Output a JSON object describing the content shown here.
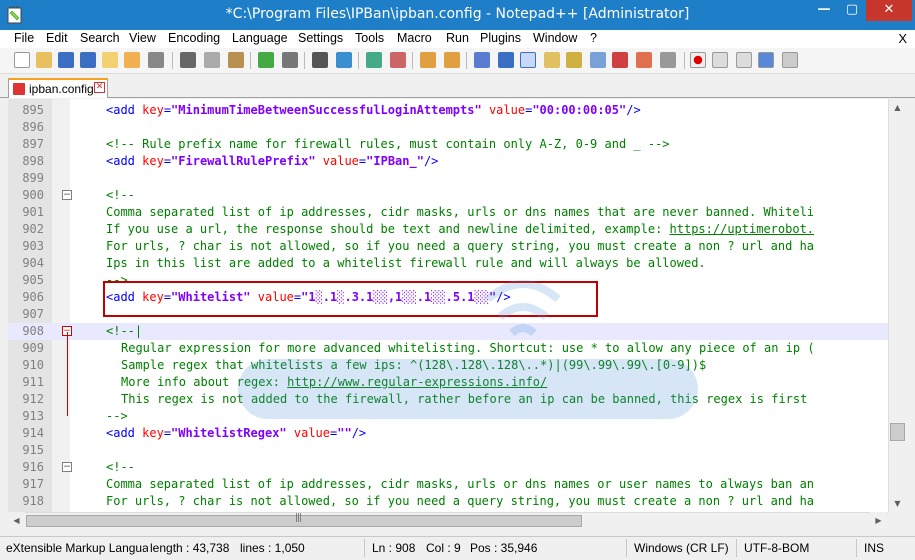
{
  "window": {
    "title": "*C:\\Program Files\\IPBan\\ipban.config - Notepad++ [Administrator]",
    "min_label": "—",
    "max_label": "▢",
    "close_label": "✕"
  },
  "menu": {
    "items": [
      "File",
      "Edit",
      "Search",
      "View",
      "Encoding",
      "Language",
      "Settings",
      "Tools",
      "Macro",
      "Run",
      "Plugins",
      "Window",
      "?"
    ],
    "close_doc": "X"
  },
  "tab": {
    "label": "ipban.config",
    "close": "✕"
  },
  "lines": [
    {
      "n": "895",
      "parts": [
        [
          "tag",
          "<add "
        ],
        [
          "attr",
          "key"
        ],
        [
          "tag",
          "="
        ],
        [
          "val",
          "\"MinimumTimeBetweenSuccessfulLoginAttempts\""
        ],
        [
          "tag",
          " "
        ],
        [
          "attr",
          "value"
        ],
        [
          "tag",
          "="
        ],
        [
          "val",
          "\"00:00:00:05\""
        ],
        [
          "tag",
          "/>"
        ]
      ]
    },
    {
      "n": "896",
      "parts": []
    },
    {
      "n": "897",
      "parts": [
        [
          "com",
          "<!-- Rule prefix name for firewall rules, must contain only A-Z, 0-9 and _ -->"
        ]
      ]
    },
    {
      "n": "898",
      "parts": [
        [
          "tag",
          "<add "
        ],
        [
          "attr",
          "key"
        ],
        [
          "tag",
          "="
        ],
        [
          "val",
          "\"FirewallRulePrefix\""
        ],
        [
          "tag",
          " "
        ],
        [
          "attr",
          "value"
        ],
        [
          "tag",
          "="
        ],
        [
          "val",
          "\"IPBan_\""
        ],
        [
          "tag",
          "/>"
        ]
      ]
    },
    {
      "n": "899",
      "parts": []
    },
    {
      "n": "900",
      "fold": "−",
      "parts": [
        [
          "com",
          "<!--"
        ]
      ]
    },
    {
      "n": "901",
      "parts": [
        [
          "com",
          "Comma separated list of ip addresses, cidr masks, urls or dns names that are never banned. Whiteli"
        ]
      ]
    },
    {
      "n": "902",
      "parts": [
        [
          "com",
          "If you use a url, the response should be text and newline delimited, example: "
        ],
        [
          "link",
          "https://uptimerobot."
        ]
      ]
    },
    {
      "n": "903",
      "parts": [
        [
          "com",
          "For urls, ? char is not allowed, so if you need a query string, you must create a non ? url and ha"
        ]
      ]
    },
    {
      "n": "904",
      "parts": [
        [
          "com",
          "Ips in this list are added to a whitelist firewall rule and will always be allowed."
        ]
      ]
    },
    {
      "n": "905",
      "parts": [
        [
          "com",
          "-->"
        ]
      ]
    },
    {
      "n": "906",
      "parts": [
        [
          "tag",
          "<add "
        ],
        [
          "attr",
          "key"
        ],
        [
          "tag",
          "="
        ],
        [
          "val",
          "\"Whitelist\""
        ],
        [
          "tag",
          " "
        ],
        [
          "attr",
          "value"
        ],
        [
          "tag",
          "="
        ],
        [
          "val",
          "\"1░.1░.3.1░░,1░░.1░░.5.1░░\""
        ],
        [
          "tag",
          "/>"
        ]
      ]
    },
    {
      "n": "907",
      "parts": []
    },
    {
      "n": "908",
      "fold": "−",
      "active": true,
      "current": true,
      "parts": [
        [
          "com",
          "<!--|"
        ]
      ]
    },
    {
      "n": "909",
      "ind": true,
      "parts": [
        [
          "com",
          "Regular expression for more advanced whitelisting. Shortcut: use * to allow any piece of an ip ("
        ]
      ]
    },
    {
      "n": "910",
      "ind": true,
      "parts": [
        [
          "com",
          "Sample regex that whitelists a few ips: ^(128\\.128\\.128\\..*)|(99\\.99\\.99\\.[0-9])$"
        ]
      ]
    },
    {
      "n": "911",
      "ind": true,
      "parts": [
        [
          "com",
          "More info about regex: "
        ],
        [
          "link",
          "http://www.regular-expressions.info/"
        ]
      ]
    },
    {
      "n": "912",
      "ind": true,
      "parts": [
        [
          "com",
          "This regex is not added to the firewall, rather before an ip can be banned, this regex is first"
        ]
      ]
    },
    {
      "n": "913",
      "parts": [
        [
          "com",
          "-->"
        ]
      ]
    },
    {
      "n": "914",
      "parts": [
        [
          "tag",
          "<add "
        ],
        [
          "attr",
          "key"
        ],
        [
          "tag",
          "="
        ],
        [
          "val",
          "\"WhitelistRegex\""
        ],
        [
          "tag",
          " "
        ],
        [
          "attr",
          "value"
        ],
        [
          "tag",
          "="
        ],
        [
          "val",
          "\"\""
        ],
        [
          "tag",
          "/>"
        ]
      ]
    },
    {
      "n": "915",
      "parts": []
    },
    {
      "n": "916",
      "fold": "−",
      "parts": [
        [
          "com",
          "<!--"
        ]
      ]
    },
    {
      "n": "917",
      "parts": [
        [
          "com",
          "Comma separated list of ip addresses, cidr masks, urls or dns names or user names to always ban an"
        ]
      ]
    },
    {
      "n": "918",
      "parts": [
        [
          "com",
          "For urls, ? char is not allowed, so if you need a query string, you must create a non ? url and ha"
        ]
      ]
    }
  ],
  "status": {
    "language": "eXtensible Markup Langua",
    "length": "length : 43,738",
    "lines": "lines : 1,050",
    "ln": "Ln : 908",
    "col": "Col : 9",
    "pos": "Pos : 35,946",
    "eol": "Windows (CR LF)",
    "encoding": "UTF-8-BOM",
    "mode": "INS"
  },
  "colors": {
    "titlebar": "#1e7ec8",
    "tag": "#0000ff",
    "attr": "#ff0000",
    "value": "#8000ff",
    "comment": "#008000",
    "highlight": "#c00000"
  }
}
